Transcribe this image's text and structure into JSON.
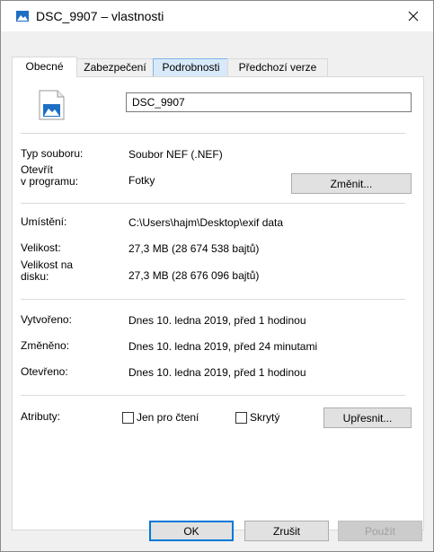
{
  "window": {
    "title": "DSC_9907 – vlastnosti"
  },
  "tabs": [
    {
      "label": "Obecné"
    },
    {
      "label": "Zabezpečení"
    },
    {
      "label": "Podrobnosti"
    },
    {
      "label": "Předchozí verze"
    }
  ],
  "general": {
    "file_name": "DSC_9907",
    "file_type_label": "Typ souboru:",
    "file_type_value": "Soubor NEF (.NEF)",
    "open_with_label_line1": "Otevřít",
    "open_with_label_line2": "v programu:",
    "open_with_value": "Fotky",
    "change_button": "Změnit...",
    "location_label": "Umístění:",
    "location_value": "C:\\Users\\hajm\\Desktop\\exif data",
    "size_label": "Velikost:",
    "size_value": "27,3 MB (28 674 538 bajtů)",
    "size_on_disk_label_line1": "Velikost na",
    "size_on_disk_label_line2": "disku:",
    "size_on_disk_value": "27,3 MB (28 676 096 bajtů)",
    "created_label": "Vytvořeno:",
    "created_value": "Dnes 10. ledna 2019, před 1 hodinou",
    "modified_label": "Změněno:",
    "modified_value": "Dnes 10. ledna 2019, před 24 minutami",
    "accessed_label": "Otevřeno:",
    "accessed_value": "Dnes 10. ledna 2019, před 1 hodinou",
    "attributes_label": "Atributy:",
    "readonly_label": "Jen pro čtení",
    "hidden_label": "Skrytý",
    "advanced_button": "Upřesnit..."
  },
  "footer": {
    "ok": "OK",
    "cancel": "Zrušit",
    "apply": "Použít"
  },
  "colors": {
    "accent": "#0078d7",
    "tab_hover": "#d8eaf9",
    "dialog_bg": "#f0f0f0"
  }
}
